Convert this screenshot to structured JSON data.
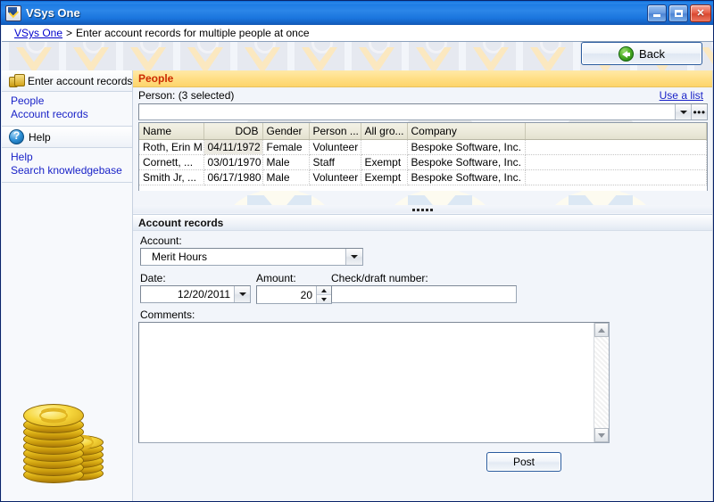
{
  "window": {
    "title": "VSys One",
    "icon": "vsys-app-icon",
    "buttons": {
      "minimize": "minimize-button",
      "maximize": "maximize-button",
      "close": "close-button",
      "close_glyph": "✕"
    }
  },
  "breadcrumb": {
    "home": "VSys One",
    "separator": ">",
    "current": "Enter account records for multiple people at once"
  },
  "header": {
    "back_label": "Back"
  },
  "sidebar": {
    "groups": [
      {
        "icon": "money-icon",
        "title": "Enter account records",
        "links": [
          {
            "label": "People"
          },
          {
            "label": "Account records"
          }
        ]
      },
      {
        "icon": "help-icon",
        "title": "Help",
        "links": [
          {
            "label": "Help"
          },
          {
            "label": "Search knowledgebase"
          }
        ]
      }
    ],
    "decoration": "gold-coins-image"
  },
  "people": {
    "section_title": "People",
    "person_label": "Person: (3 selected)",
    "person_value": "",
    "use_a_list": "Use a list",
    "dropdown_icon": "chevron-down-icon",
    "browse_icon": "ellipsis-icon",
    "table": {
      "columns": [
        "Name",
        "DOB",
        "Gender",
        "Person ...",
        "All gro...",
        "Company",
        ""
      ],
      "rows": [
        {
          "name": "Roth, Erin M",
          "dob": "04/11/1972",
          "gender": "Female",
          "person_type": "Volunteer",
          "all_groups": "",
          "company": "Bespoke Software, Inc.",
          "extra": ""
        },
        {
          "name": "Cornett, ...",
          "dob": "03/01/1970",
          "gender": "Male",
          "person_type": "Staff",
          "all_groups": "Exempt",
          "company": "Bespoke Software, Inc.",
          "extra": ""
        },
        {
          "name": "Smith Jr, ...",
          "dob": "06/17/1980",
          "gender": "Male",
          "person_type": "Volunteer",
          "all_groups": "Exempt",
          "company": "Bespoke Software, Inc.",
          "extra": ""
        }
      ]
    }
  },
  "account_records": {
    "section_title": "Account records",
    "account_label": "Account:",
    "account_value": "Merit Hours",
    "date_label": "Date:",
    "date_value": "12/20/2011",
    "amount_label": "Amount:",
    "amount_value": "20",
    "check_label": "Check/draft number:",
    "check_value": "",
    "check_placeholder": "",
    "comments_label": "Comments:",
    "comments_value": "",
    "comments_placeholder": "",
    "post_label": "Post"
  },
  "colors": {
    "titlebar_blue": "#1e7ce4",
    "people_header_yellow": "#ffdf86",
    "people_header_text": "#cc2b00",
    "link_blue": "#1a23c8",
    "button_border": "#2b5c9e",
    "back_arrow_green": "#4fb026"
  }
}
